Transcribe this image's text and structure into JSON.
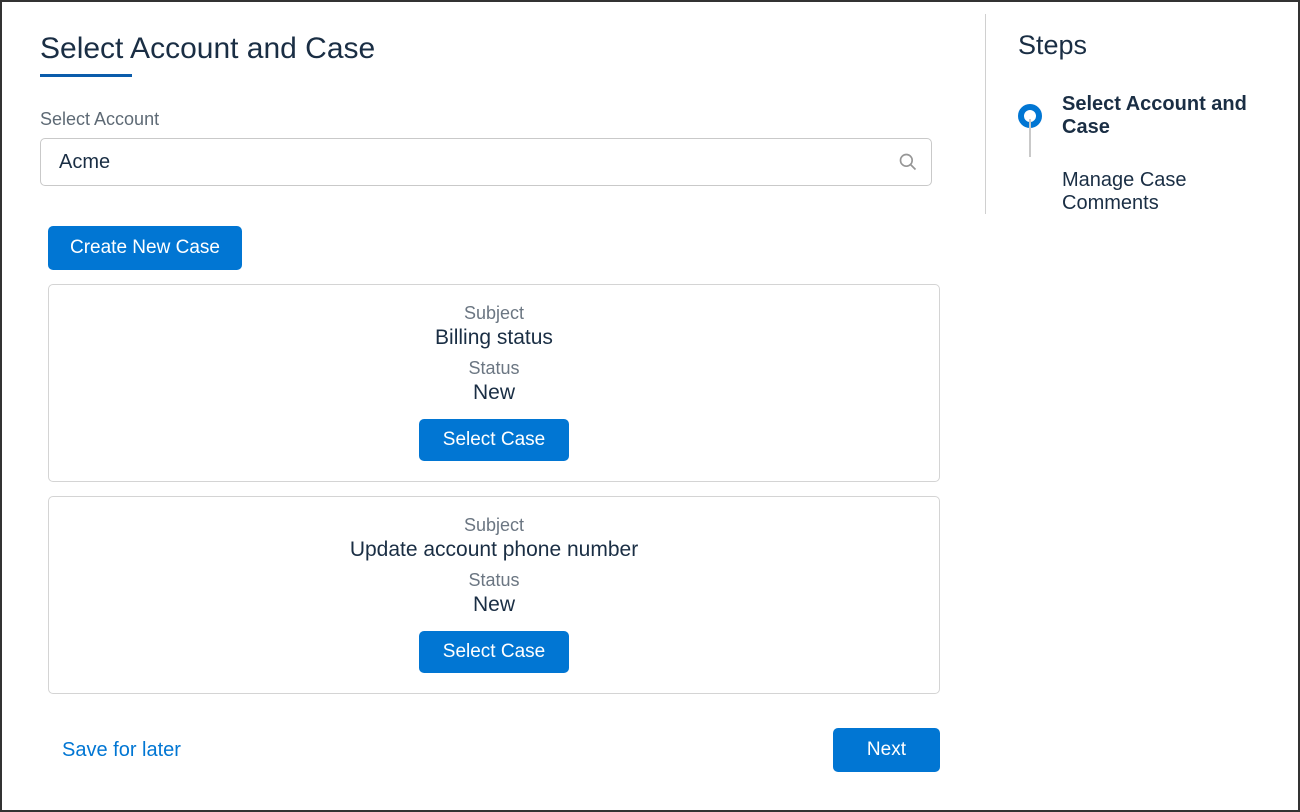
{
  "page": {
    "title": "Select Account and Case"
  },
  "account": {
    "label": "Select Account",
    "value": "Acme"
  },
  "buttons": {
    "create_case": "Create New Case",
    "select_case": "Select Case",
    "save_for_later": "Save for later",
    "next": "Next"
  },
  "case_fields": {
    "subject_label": "Subject",
    "status_label": "Status"
  },
  "cases": [
    {
      "subject": "Billing status",
      "status": "New"
    },
    {
      "subject": "Update account phone number",
      "status": "New"
    }
  ],
  "steps": {
    "heading": "Steps",
    "items": [
      {
        "label": "Select Account and Case",
        "active": true
      },
      {
        "label": "Manage Case Comments",
        "active": false
      }
    ]
  }
}
